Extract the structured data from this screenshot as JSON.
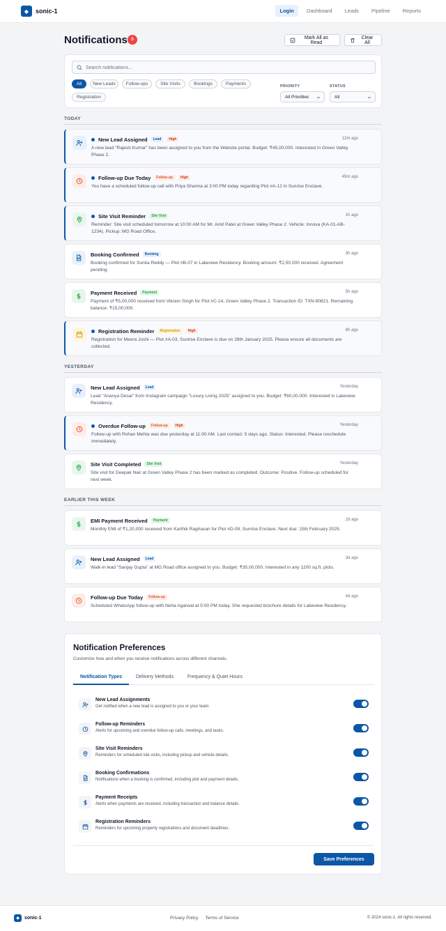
{
  "app": {
    "name": "sonic-1",
    "logo_glyph": "◆"
  },
  "nav": [
    {
      "label": "Login",
      "active": true
    },
    {
      "label": "Dashboard"
    },
    {
      "label": "Leads"
    },
    {
      "label": "Pipeline"
    },
    {
      "label": "Reports"
    }
  ],
  "page": {
    "title": "Notifications",
    "count": "5",
    "mark_all": "Mark All as Read",
    "clear_all": "Clear All"
  },
  "filters": {
    "search_placeholder": "Search notifications...",
    "chips": [
      "All",
      "New Leads",
      "Follow-ups",
      "Site Visits",
      "Bookings",
      "Payments",
      "Registration"
    ],
    "active_chip": "All",
    "priority_label": "PRIORITY",
    "priority_value": "All Priorities",
    "status_label": "STATUS",
    "status_value": "All"
  },
  "sections": [
    {
      "label": "TODAY",
      "items": [
        {
          "icon": "user-plus-icon",
          "kind": "lead",
          "unread": true,
          "title": "New Lead Assigned",
          "tag": "Lead",
          "priority": "High",
          "time": "12m ago",
          "desc": "A new lead \"Rajesh Kumar\" has been assigned to you from the Website portal. Budget: ₹45,00,000. Interested in Green Valley Phase 2."
        },
        {
          "icon": "clock-icon",
          "kind": "follow",
          "unread": true,
          "title": "Follow-up Due Today",
          "tag": "Follow-up",
          "priority": "High",
          "time": "45m ago",
          "desc": "You have a scheduled follow-up call with Priya Sharma at 3:00 PM today regarding Plot #A-12 in Sunrise Enclave."
        },
        {
          "icon": "map-pin-icon",
          "kind": "visit",
          "unread": true,
          "title": "Site Visit Reminder",
          "tag": "Site Visit",
          "priority": "",
          "time": "1h ago",
          "desc": "Reminder: Site visit scheduled tomorrow at 10:00 AM for Mr. Amit Patel at Green Valley Phase 2. Vehicle: Innova (KA-01-AB-1234). Pickup: MG Road Office."
        },
        {
          "icon": "document-icon",
          "kind": "booking",
          "unread": false,
          "title": "Booking Confirmed",
          "tag": "Booking",
          "priority": "",
          "time": "3h ago",
          "desc": "Booking confirmed for Sunita Reddy — Plot #B-07 in Lakeview Residency. Booking amount: ₹2,50,000 received. Agreement pending."
        },
        {
          "icon": "dollar-icon",
          "kind": "pay",
          "unread": false,
          "title": "Payment Received",
          "tag": "Payment",
          "priority": "",
          "time": "5h ago",
          "desc": "Payment of ₹5,00,000 received from Vikram Singh for Plot #C-14, Green Valley Phase 2. Transaction ID: TXN-90821. Remaining balance: ₹15,00,000."
        },
        {
          "icon": "calendar-icon",
          "kind": "reg",
          "unread": true,
          "title": "Registration Reminder",
          "tag": "Registration",
          "priority": "High",
          "time": "8h ago",
          "desc": "Registration for Meera Joshi — Plot #A-03, Sunrise Enclave is due on 28th January 2025. Please ensure all documents are collected."
        }
      ]
    },
    {
      "label": "YESTERDAY",
      "items": [
        {
          "icon": "user-plus-icon",
          "kind": "lead",
          "unread": false,
          "title": "New Lead Assigned",
          "tag": "Lead",
          "priority": "",
          "time": "Yesterday",
          "desc": "Lead \"Ananya Desai\" from Instagram campaign \"Luxury Living 2025\" assigned to you. Budget: ₹60,00,000. Interested in Lakeview Residency."
        },
        {
          "icon": "clock-icon",
          "kind": "follow",
          "unread": true,
          "title": "Overdue Follow-up",
          "tag": "Follow-up",
          "priority": "High",
          "time": "Yesterday",
          "desc": "Follow-up with Rohan Mehta was due yesterday at 11:00 AM. Last contact: 5 days ago. Status: Interested. Please reschedule immediately."
        },
        {
          "icon": "map-pin-icon",
          "kind": "visit",
          "unread": false,
          "title": "Site Visit Completed",
          "tag": "Site Visit",
          "priority": "",
          "time": "Yesterday",
          "desc": "Site visit for Deepak Nair at Green Valley Phase 2 has been marked as completed. Outcome: Positive. Follow-up scheduled for next week."
        }
      ]
    },
    {
      "label": "EARLIER THIS WEEK",
      "items": [
        {
          "icon": "dollar-icon",
          "kind": "pay",
          "unread": false,
          "title": "EMI Payment Received",
          "tag": "Payment",
          "priority": "",
          "time": "2d ago",
          "desc": "Monthly EMI of ₹1,20,000 received from Karthik Raghavan for Plot #D-09, Sunrise Enclave. Next due: 15th February 2025."
        },
        {
          "icon": "user-plus-icon",
          "kind": "lead",
          "unread": false,
          "title": "New Lead Assigned",
          "tag": "Lead",
          "priority": "",
          "time": "3d ago",
          "desc": "Walk-in lead \"Sanjay Gupta\" at MG Road office assigned to you. Budget: ₹35,00,000. Interested in any 1200 sq.ft. plots."
        },
        {
          "icon": "clock-icon",
          "kind": "follow",
          "unread": false,
          "title": "Follow-up Due Today",
          "tag": "Follow-up",
          "priority": "",
          "time": "4d ago",
          "desc": "Scheduled WhatsApp follow-up with Neha Agarwal at 5:00 PM today. She requested brochure details for Lakeview Residency."
        }
      ]
    }
  ],
  "preferences": {
    "title": "Notification Preferences",
    "subtitle": "Customize how and when you receive notifications across different channels.",
    "tabs": [
      "Notification Types",
      "Delivery Methods",
      "Frequency & Quiet Hours"
    ],
    "items": [
      {
        "icon": "user-plus-icon",
        "name": "New Lead Assignments",
        "desc": "Get notified when a new lead is assigned to you or your team.",
        "enabled": true
      },
      {
        "icon": "clock-icon",
        "name": "Follow-up Reminders",
        "desc": "Alerts for upcoming and overdue follow-up calls, meetings, and tasks.",
        "enabled": true
      },
      {
        "icon": "map-pin-icon",
        "name": "Site Visit Reminders",
        "desc": "Reminders for scheduled site visits, including pickup and vehicle details.",
        "enabled": true
      },
      {
        "icon": "document-icon",
        "name": "Booking Confirmations",
        "desc": "Notifications when a booking is confirmed, including plot and payment details.",
        "enabled": true
      },
      {
        "icon": "dollar-icon",
        "name": "Payment Receipts",
        "desc": "Alerts when payments are received, including transaction and balance details.",
        "enabled": true
      },
      {
        "icon": "calendar-icon",
        "name": "Registration Reminders",
        "desc": "Reminders for upcoming property registrations and document deadlines.",
        "enabled": true
      }
    ],
    "save_label": "Save Preferences"
  },
  "footer": {
    "brand": "sonic-1",
    "links": [
      "Privacy Policy",
      "Terms of Service"
    ],
    "copyright": "© 2024 sonic-1. All rights reserved."
  },
  "colors": {
    "primary": "#0b57a6",
    "danger": "#ef4444",
    "success": "#22a447",
    "warning": "#d19a06",
    "orange": "#e0562c"
  }
}
